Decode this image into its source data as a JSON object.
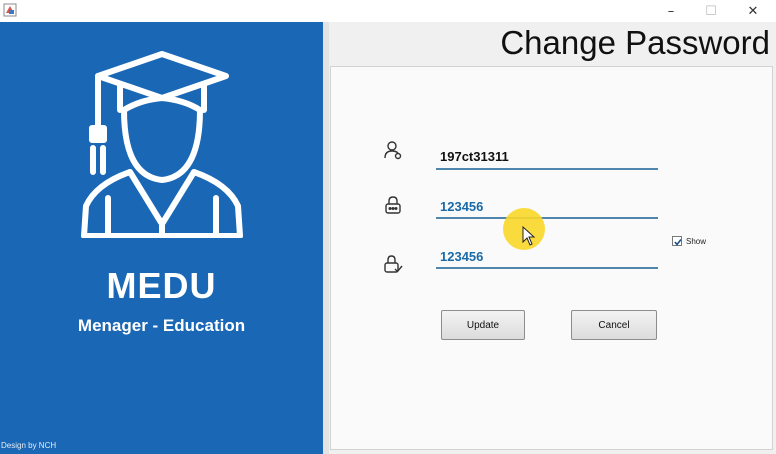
{
  "window": {
    "minimize_glyph": "–",
    "maximize_glyph": "☐",
    "close_glyph": "✕"
  },
  "sidebar": {
    "brand": "MEDU",
    "tagline": "Menager - Education",
    "credit": "Design by NCH",
    "background": "#1a67b5"
  },
  "page": {
    "title": "Change Password"
  },
  "form": {
    "username": "197ct31311",
    "old_password": "123456",
    "new_password": "123456",
    "show_label": "Show",
    "show_checked": true,
    "update_label": "Update",
    "cancel_label": "Cancel",
    "value_color_user": "#111111",
    "value_color_password": "#1a6aa8"
  },
  "icons": {
    "app": "app-icon",
    "logo": "graduate-icon",
    "user": "user-icon",
    "lock": "lock-icon",
    "confirm": "lock-check-icon"
  }
}
